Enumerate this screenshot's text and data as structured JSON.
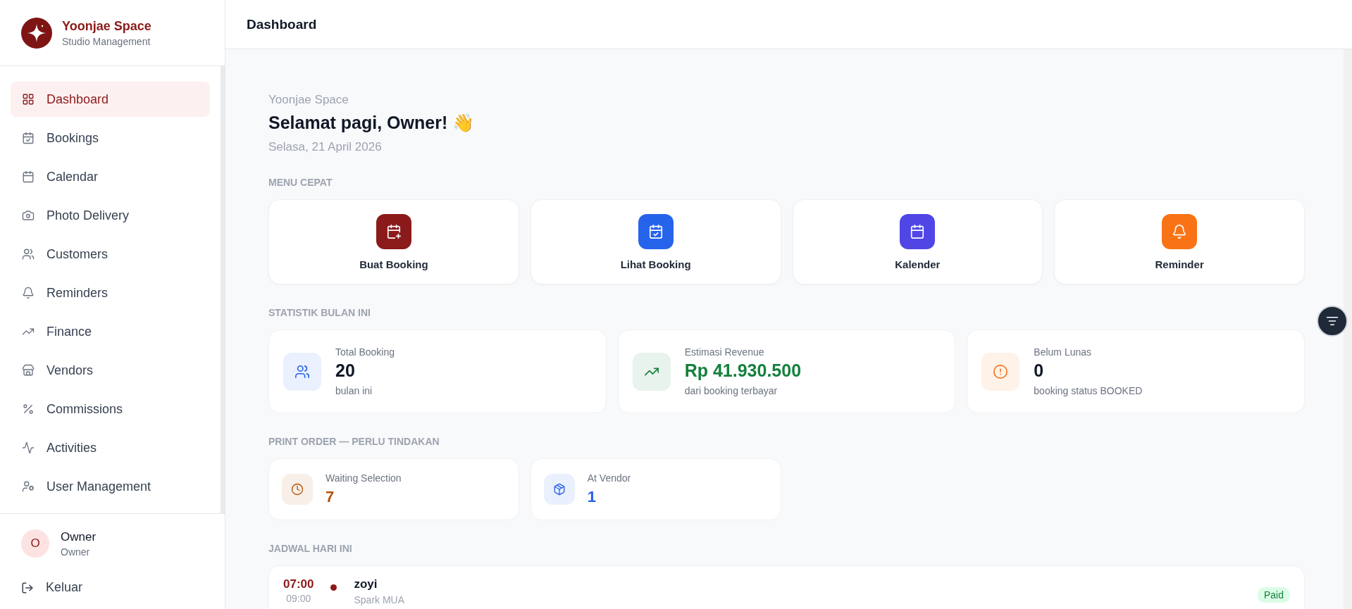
{
  "brand": {
    "name": "Yoonjae Space",
    "subtitle": "Studio Management"
  },
  "sidebar": {
    "items": [
      {
        "label": "Dashboard",
        "selected": true
      },
      {
        "label": "Bookings",
        "selected": false
      },
      {
        "label": "Calendar",
        "selected": false
      },
      {
        "label": "Photo Delivery",
        "selected": false
      },
      {
        "label": "Customers",
        "selected": false
      },
      {
        "label": "Reminders",
        "selected": false
      },
      {
        "label": "Finance",
        "selected": false
      },
      {
        "label": "Vendors",
        "selected": false
      },
      {
        "label": "Commissions",
        "selected": false
      },
      {
        "label": "Activities",
        "selected": false
      },
      {
        "label": "User Management",
        "selected": false
      }
    ]
  },
  "user": {
    "initial": "O",
    "name": "Owner",
    "role": "Owner"
  },
  "logout": {
    "label": "Keluar"
  },
  "header": {
    "title": "Dashboard"
  },
  "greeting": {
    "studio": "Yoonjae Space",
    "title": "Selamat pagi, Owner! 👋",
    "date": "Selasa, 21 April 2026"
  },
  "quick_menu": {
    "heading": "MENU CEPAT",
    "items": [
      {
        "label": "Buat Booking",
        "color": "#8b1a1a"
      },
      {
        "label": "Lihat Booking",
        "color": "#2563eb"
      },
      {
        "label": "Kalender",
        "color": "#4f46e5"
      },
      {
        "label": "Reminder",
        "color": "#f97316"
      }
    ]
  },
  "stats": {
    "heading": "STATISTIK BULAN INI",
    "items": [
      {
        "label": "Total Booking",
        "value": "20",
        "note": "bulan ini",
        "color": "#2563eb"
      },
      {
        "label": "Estimasi Revenue",
        "value": "Rp 41.930.500",
        "note": "dari booking terbayar",
        "color": "#15803d"
      },
      {
        "label": "Belum Lunas",
        "value": "0",
        "note": "booking status BOOKED",
        "color": "#f97316"
      }
    ]
  },
  "print_orders": {
    "heading": "PRINT ORDER — PERLU TINDAKAN",
    "items": [
      {
        "label": "Waiting Selection",
        "value": "7",
        "color": "#b45309"
      },
      {
        "label": "At Vendor",
        "value": "1",
        "color": "#2563eb"
      }
    ]
  },
  "schedule": {
    "heading": "JADWAL HARI INI",
    "items": [
      {
        "start": "07:00",
        "end": "09:00",
        "customer": "zoyi",
        "service": "Spark MUA",
        "status": "Paid",
        "color": "#8b1a1a"
      }
    ]
  }
}
